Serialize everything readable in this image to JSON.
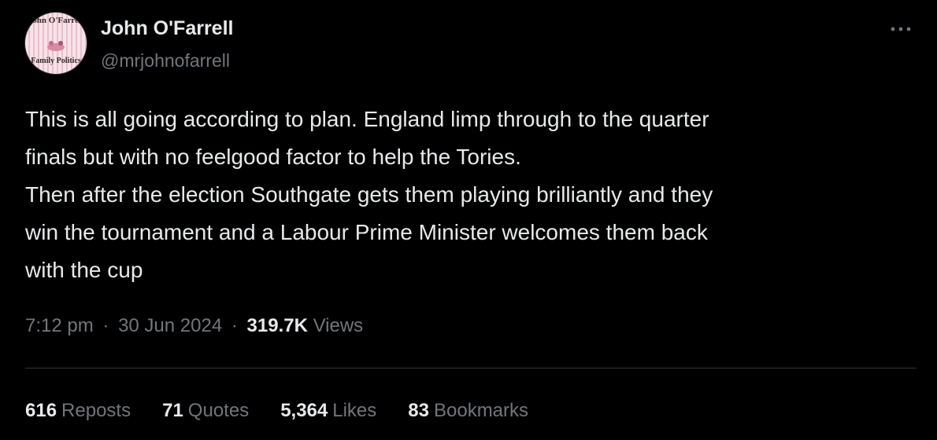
{
  "author": {
    "name": "John O'Farrell",
    "handle": "@mrjohnofarrell",
    "avatar_text_top": "John O'Farrell",
    "avatar_text_bottom": "Family Politics"
  },
  "more_icon": "more-horizontal-icon",
  "tweet": {
    "lines": [
      "This is all going according to plan. England limp through to the quarter",
      "finals but with no feelgood factor to help the Tories.",
      "Then after the election Southgate gets them playing brilliantly and they",
      "win the tournament and a Labour Prime Minister welcomes them back",
      "with the cup"
    ]
  },
  "meta": {
    "time": "7:12 pm",
    "date": "30 Jun 2024",
    "views_count": "319.7K",
    "views_label": "Views",
    "separator": "·"
  },
  "stats": {
    "reposts": {
      "count": "616",
      "label": "Reposts"
    },
    "quotes": {
      "count": "71",
      "label": "Quotes"
    },
    "likes": {
      "count": "5,364",
      "label": "Likes"
    },
    "bookmarks": {
      "count": "83",
      "label": "Bookmarks"
    }
  },
  "colors": {
    "background": "#000000",
    "primary_text": "#e7e9ea",
    "secondary_text": "#71767b",
    "divider": "#2f3336"
  }
}
